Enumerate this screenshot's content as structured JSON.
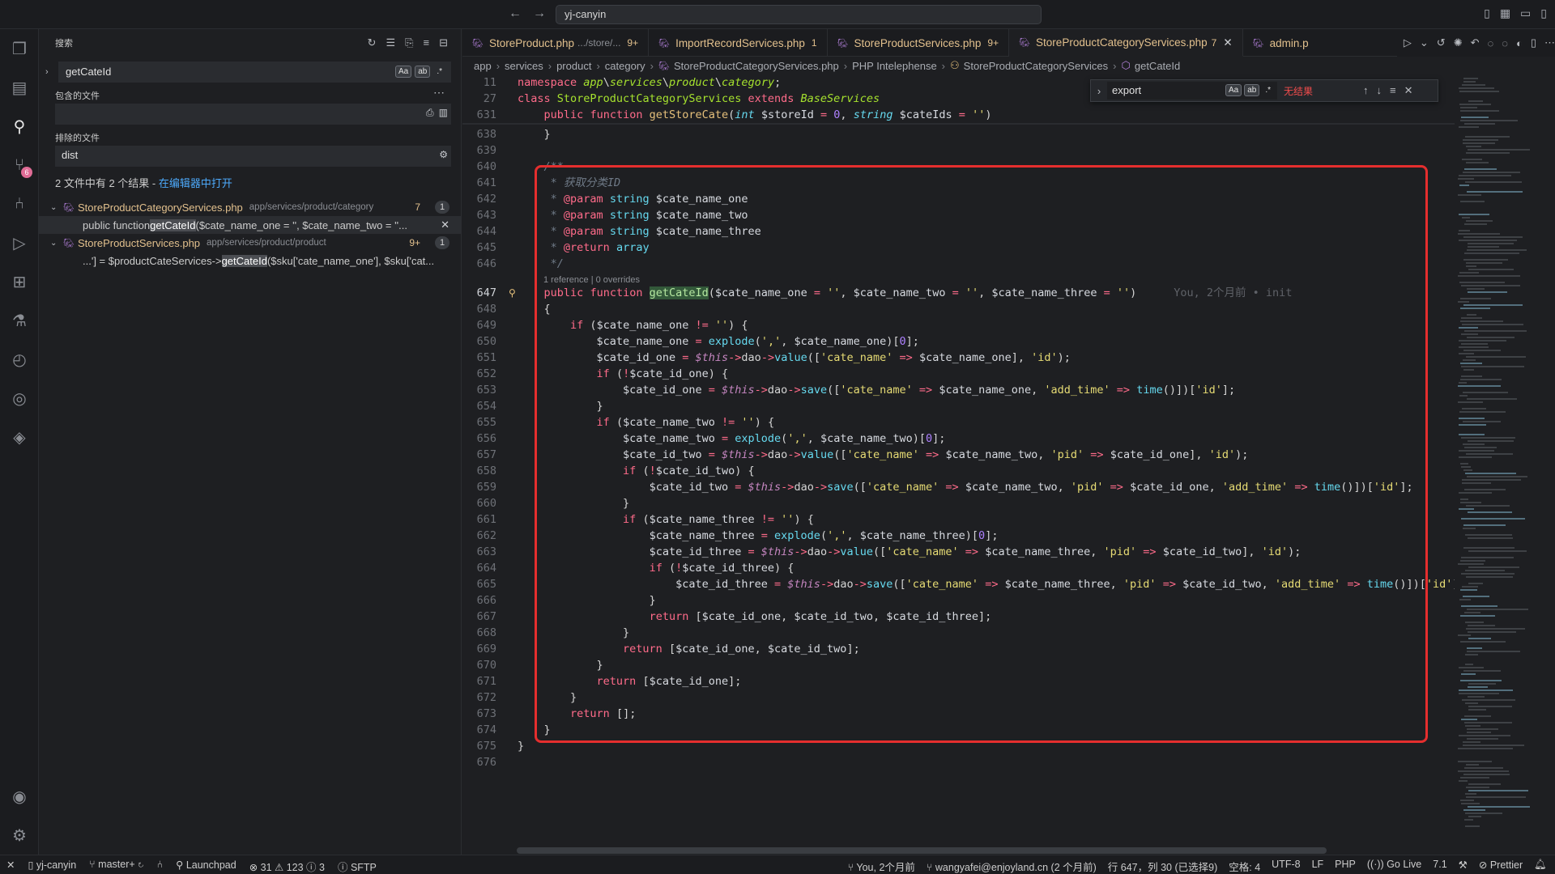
{
  "titlebar": {
    "command_center": "yj-canyin"
  },
  "activity": {
    "scm_badge": "6"
  },
  "sidebar": {
    "title": "搜索",
    "query": "getCateId",
    "include_label": "包含的文件",
    "exclude_label": "排除的文件",
    "exclude_value": "dist",
    "summary_text": "2 文件中有 2 个结果 - ",
    "summary_link": "在编辑器中打开",
    "files": [
      {
        "name": "StoreProductCategoryServices.php",
        "path": "app/services/product/category",
        "count": "7",
        "badge": "1",
        "match_pre": "public function ",
        "match_hl": "getCateId",
        "match_post": "($cate_name_one = '', $cate_name_two = ''..."
      },
      {
        "name": "StoreProductServices.php",
        "path": "app/services/product/product",
        "count": "9+",
        "badge": "1",
        "match_pre": "...'] = $productCateServices->",
        "match_hl": "getCateId",
        "match_post": "($sku['cate_name_one'], $sku['cat..."
      }
    ]
  },
  "tabs": [
    {
      "name": "StoreProduct.php",
      "desc": ".../store/...",
      "count": "9+"
    },
    {
      "name": "ImportRecordServices.php",
      "desc": "",
      "count": "1"
    },
    {
      "name": "StoreProductServices.php",
      "desc": "",
      "count": "9+"
    },
    {
      "name": "StoreProductCategoryServices.php",
      "desc": "",
      "count": "7"
    },
    {
      "name": "admin.p",
      "desc": "",
      "count": ""
    }
  ],
  "breadcrumb": [
    "app",
    "services",
    "product",
    "category",
    "StoreProductCategoryServices.php",
    "PHP Intelephense",
    "StoreProductCategoryServices",
    "getCateId"
  ],
  "find": {
    "query": "export",
    "result": "无结果"
  },
  "editor": {
    "codelens": "1 reference | 0 overrides",
    "blame": "You, 2个月前 • init"
  },
  "lines": [
    "11",
    "27",
    "631",
    "638",
    "639",
    "640",
    "641",
    "642",
    "643",
    "644",
    "645",
    "646",
    "647",
    "648",
    "649",
    "650",
    "651",
    "652",
    "653",
    "654",
    "655",
    "656",
    "657",
    "658",
    "659",
    "660",
    "661",
    "662",
    "663",
    "664",
    "665",
    "666",
    "667",
    "668",
    "669",
    "670",
    "671",
    "672",
    "673",
    "674",
    "675",
    "676"
  ],
  "statusbar": {
    "remote": "yj-canyin",
    "branch": "master+",
    "launchpad": "Launchpad",
    "errors": "31",
    "warnings": "123",
    "infos": "3",
    "sftp": "SFTP",
    "blame": "You, 2个月前",
    "author": "wangyafei@enjoyland.cn (2 个月前)",
    "position": "行 647，列 30 (已选择9)",
    "spaces": "空格: 4",
    "encoding": "UTF-8",
    "eol": "LF",
    "language": "PHP",
    "golive": "Go Live",
    "version": "7.1",
    "prettier": "Prettier"
  }
}
